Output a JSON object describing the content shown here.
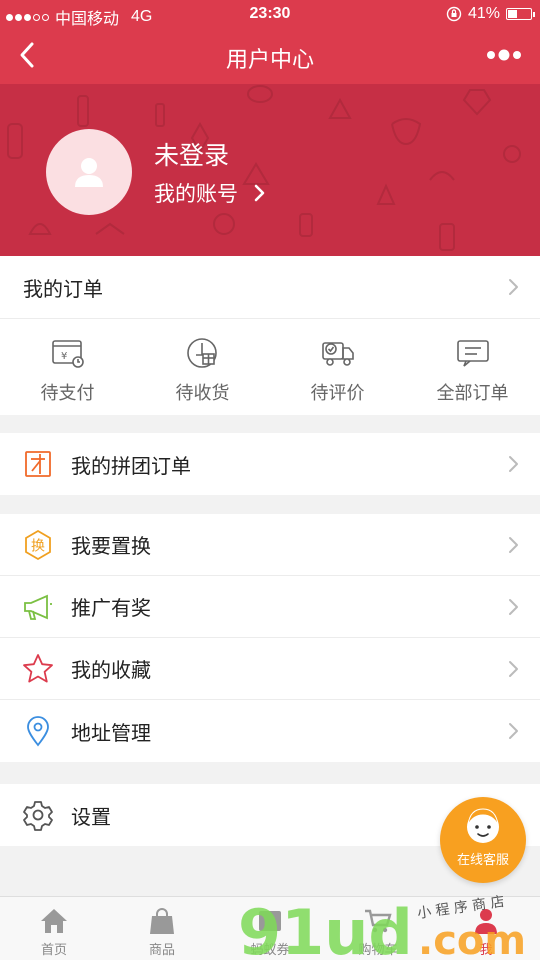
{
  "status_bar": {
    "carrier": "中国移动",
    "network": "4G",
    "time": "23:30",
    "battery": "41%",
    "battery_level": 0.41,
    "signal_bars": 3
  },
  "nav": {
    "title": "用户中心"
  },
  "profile": {
    "login_title": "未登录",
    "account_link": "我的账号"
  },
  "orders": {
    "header": "我的订单",
    "items": [
      {
        "label": "待支付",
        "icon": "wallet-icon"
      },
      {
        "label": "待收货",
        "icon": "package-icon"
      },
      {
        "label": "待评价",
        "icon": "truck-icon"
      },
      {
        "label": "全部订单",
        "icon": "list-icon"
      }
    ]
  },
  "group_buy": {
    "label": "我的拼团订单"
  },
  "menu": {
    "exchange": "我要置换",
    "exchange_icon_text": "换",
    "promote": "推广有奖",
    "favorites": "我的收藏",
    "address": "地址管理"
  },
  "settings": {
    "label": "设置"
  },
  "customer_service": {
    "label": "在线客服"
  },
  "tabbar": {
    "items": [
      {
        "label": "首页",
        "icon": "home-icon"
      },
      {
        "label": "商品",
        "icon": "shopping-bag-icon"
      },
      {
        "label": "蚂蚁券",
        "icon": "coupon-icon"
      },
      {
        "label": "购物车",
        "icon": "cart-icon"
      },
      {
        "label": "我",
        "icon": "user-icon"
      }
    ],
    "active_index": 4
  },
  "watermark": {
    "brand": "91ud",
    "suffix": ".com",
    "tagline": "小 程 序 商 店"
  },
  "colors": {
    "primary": "#dc3b4d",
    "header_bg": "#c62f45",
    "service": "#f8a020"
  }
}
